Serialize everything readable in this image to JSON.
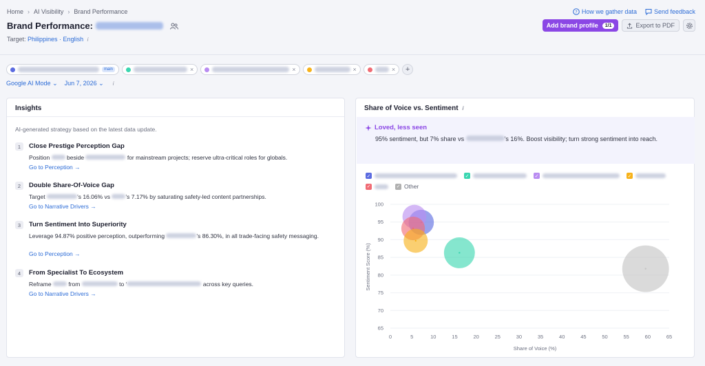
{
  "breadcrumb": [
    "Home",
    "AI Visibility",
    "Brand Performance"
  ],
  "page": {
    "title": "Brand Performance:",
    "target_label": "Target:",
    "target_value": "Philippines · English"
  },
  "top_links": {
    "how": "How we gather data",
    "feedback": "Send feedback"
  },
  "actions": {
    "add_brand": "Add brand profile",
    "add_badge": "1/1",
    "export": "Export to PDF"
  },
  "chips": [
    {
      "color": "#5b6be0",
      "main": "main"
    },
    {
      "color": "#3ad6b0"
    },
    {
      "color": "#b98cf1"
    },
    {
      "color": "#f7b21a"
    },
    {
      "color": "#f06b74"
    }
  ],
  "filters": {
    "mode": "Google AI Mode",
    "date": "Jun 7, 2026"
  },
  "insights": {
    "title": "Insights",
    "subtitle": "AI-generated strategy based on the latest data update.",
    "items": [
      {
        "num": "1",
        "head": "Close Prestige Perception Gap",
        "p1": "Position",
        "p2": "beside",
        "p3": "for mainstream projects; reserve ultra-critical roles for globals.",
        "link": "Go to Perception →"
      },
      {
        "num": "2",
        "head": "Double Share-Of-Voice Gap",
        "p1": "Target",
        "p2": "’s 16.06% vs",
        "p3": "’s 7.17% by saturating safety-led content partnerships.",
        "link": "Go to Narrative Drivers →"
      },
      {
        "num": "3",
        "head": "Turn Sentiment Into Superiority",
        "p1": "Leverage 94.87% positive perception, outperforming",
        "p2": "’s 86.30%, in all trade-facing safety",
        "p3": "messaging.",
        "link": "Go to Perception →"
      },
      {
        "num": "4",
        "head": "From Specialist To Ecosystem",
        "p1": "Reframe",
        "p2": "from",
        "p3": "to ‘",
        "p4": "across key queries.",
        "link": "Go to Narrative Drivers →"
      }
    ]
  },
  "sov": {
    "title": "Share of Voice vs. Sentiment",
    "callout_title": "Loved, less seen",
    "callout_p1": "95% sentiment, but 7% share vs",
    "callout_p2": "’s 16%. Boost visibility; turn strong sentiment into",
    "callout_p3": "reach.",
    "other_label": "Other"
  },
  "chart_data": {
    "type": "scatter",
    "xlabel": "Share of Voice (%)",
    "ylabel": "Sentiment Score (%)",
    "xlim": [
      0,
      65
    ],
    "ylim": [
      65,
      100
    ],
    "xticks": [
      0,
      5,
      10,
      15,
      20,
      25,
      30,
      35,
      40,
      45,
      50,
      55,
      60,
      65
    ],
    "yticks": [
      65,
      70,
      75,
      80,
      85,
      90,
      95,
      100
    ],
    "points": [
      {
        "x": 7.2,
        "y": 94.9,
        "color": "#5b6be0"
      },
      {
        "x": 5.6,
        "y": 96.5,
        "color": "#b98cf1"
      },
      {
        "x": 5.3,
        "y": 93.2,
        "color": "#f06b74"
      },
      {
        "x": 5.9,
        "y": 89.7,
        "color": "#f7b21a"
      },
      {
        "x": 16.1,
        "y": 86.3,
        "color": "#3ad6b0"
      },
      {
        "x": 59.5,
        "y": 81.8,
        "color": "#c4c4c4"
      }
    ],
    "legend_colors": [
      "#5b6be0",
      "#3ad6b0",
      "#b98cf1",
      "#f7b21a",
      "#f06b74",
      "#b0b0b0"
    ]
  }
}
